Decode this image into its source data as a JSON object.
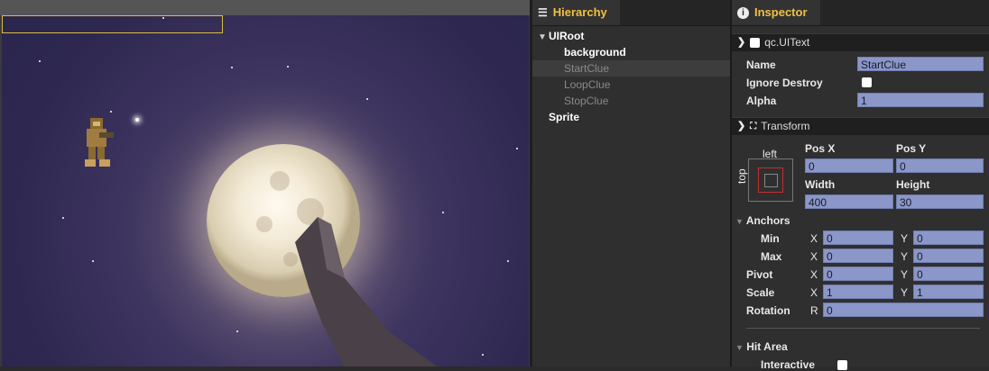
{
  "hierarchy": {
    "tab_label": "Hierarchy",
    "icon": "list-icon",
    "nodes": [
      {
        "label": "UIRoot"
      },
      {
        "label": "background"
      },
      {
        "label": "StartClue"
      },
      {
        "label": "LoopClue"
      },
      {
        "label": "StopClue"
      },
      {
        "label": "Sprite"
      }
    ]
  },
  "inspector": {
    "tab_label": "Inspector",
    "icon": "info-icon",
    "component": {
      "title": "qc.UIText",
      "name_label": "Name",
      "name_value": "StartClue",
      "ignore_destroy_label": "Ignore Destroy",
      "alpha_label": "Alpha",
      "alpha_value": "1"
    },
    "transform": {
      "title": "Transform",
      "anchor_left": "left",
      "anchor_top": "top",
      "posx_label": "Pos X",
      "posy_label": "Pos Y",
      "posx_value": "0",
      "posy_value": "0",
      "width_label": "Width",
      "height_label": "Height",
      "width_value": "400",
      "height_value": "30",
      "anchors_label": "Anchors",
      "min_label": "Min",
      "max_label": "Max",
      "pivot_label": "Pivot",
      "scale_label": "Scale",
      "rotation_label": "Rotation",
      "x_letter": "X",
      "y_letter": "Y",
      "r_letter": "R",
      "min_x": "0",
      "min_y": "0",
      "max_x": "0",
      "max_y": "0",
      "pivot_x": "0",
      "pivot_y": "0",
      "scale_x": "1",
      "scale_y": "1",
      "rotation_value": "0"
    },
    "hit_area": {
      "label": "Hit Area",
      "interactive_label": "Interactive"
    }
  }
}
